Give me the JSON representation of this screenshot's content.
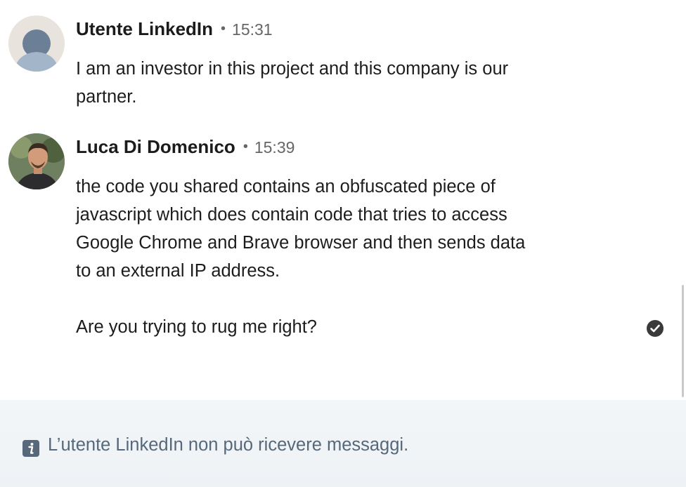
{
  "messages": [
    {
      "sender": "Utente LinkedIn",
      "time": "15:31",
      "avatar_icon": "generic-user-avatar",
      "lines": [
        "I am an investor in this project and this company is our",
        "partner."
      ]
    },
    {
      "sender": "Luca Di Domenico",
      "time": "15:39",
      "avatar_icon": "profile-photo-avatar",
      "lines": [
        "the code you shared contains an obfuscated piece of",
        "javascript which does contain code that tries to access",
        "Google Chrome and Brave browser and then sends data",
        "to an external IP address.",
        "",
        "Are you trying to rug me right?"
      ]
    }
  ],
  "separator": "•",
  "read_receipt_icon": "check-circle-icon",
  "footer": {
    "icon": "info-icon",
    "text": "L’utente LinkedIn non può ricevere messaggi."
  },
  "colors": {
    "footer_bg": "#f3f6f8",
    "footer_text": "#56687a",
    "name": "#1b1b1b",
    "time": "#666666"
  }
}
